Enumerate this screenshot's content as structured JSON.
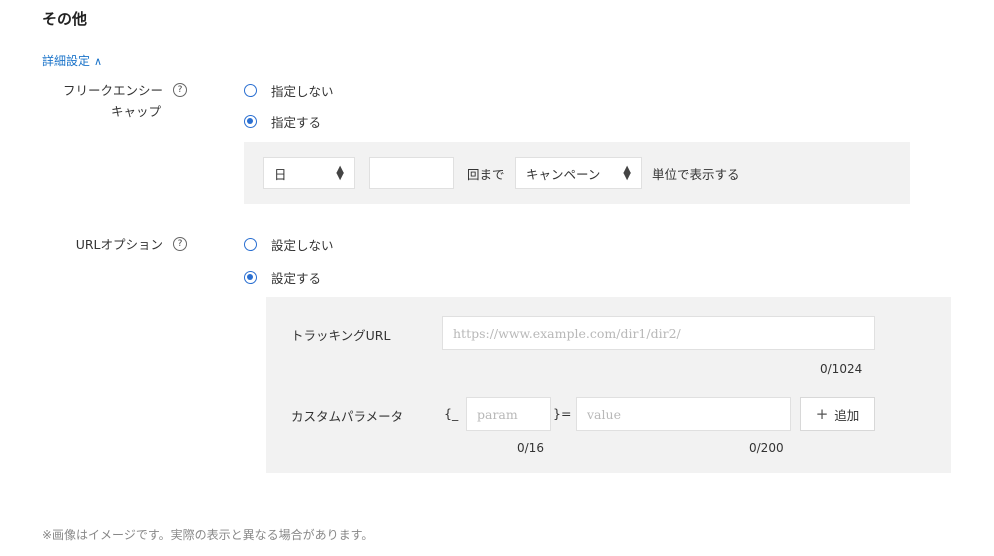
{
  "section": {
    "title": "その他"
  },
  "details": {
    "label": "詳細設定",
    "chevron": "^"
  },
  "frequency_cap": {
    "label_line1": "フリークエンシー",
    "label_line2": "キャップ",
    "help": "?",
    "options": [
      "指定しない",
      "指定する"
    ],
    "selected_index": 1,
    "period": {
      "value": "日"
    },
    "count": {
      "value": ""
    },
    "times_label": "回まで",
    "unit": {
      "value": "キャンペーン"
    },
    "suffix_label": "単位で表示する"
  },
  "url_option": {
    "label": "URLオプション",
    "help": "?",
    "options": [
      "設定しない",
      "設定する"
    ],
    "selected_index": 1,
    "tracking": {
      "label": "トラッキングURL",
      "placeholder": "https://www.example.com/dir1/dir2/",
      "counter": "0/1024"
    },
    "custom_param": {
      "label": "カスタムパラメータ",
      "prefix": "{_",
      "param_placeholder": "param",
      "middle": "}=",
      "value_placeholder": "value",
      "param_counter": "0/16",
      "value_counter": "0/200",
      "add_button": "追加",
      "add_icon": "plus-icon"
    }
  },
  "footnote": "※画像はイメージです。実際の表示と異なる場合があります。",
  "colors": {
    "accent": "#2a6fd1",
    "link": "#1a73c9",
    "panel": "#f2f2f2"
  }
}
